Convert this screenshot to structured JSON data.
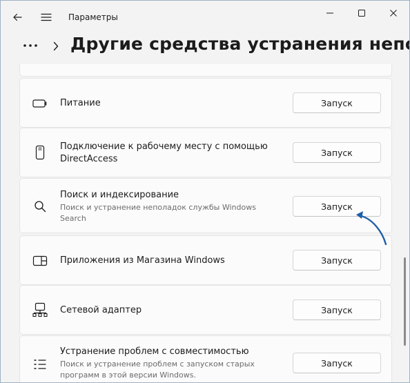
{
  "window": {
    "title": "Параметры"
  },
  "header": {
    "page_title": "Другие средства устранения неполадок"
  },
  "items": [
    {
      "icon": "battery-icon",
      "title": "Питание",
      "description": "",
      "button": "Запуск"
    },
    {
      "icon": "mobile-device-icon",
      "title": "Подключение к рабочему месту с помощью DirectAccess",
      "description": "",
      "button": "Запуск"
    },
    {
      "icon": "search-icon",
      "title": "Поиск и индексирование",
      "description": "Поиск и устранение неполадок службы Windows Search",
      "button": "Запуск"
    },
    {
      "icon": "store-apps-icon",
      "title": "Приложения из Магазина Windows",
      "description": "",
      "button": "Запуск"
    },
    {
      "icon": "network-adapter-icon",
      "title": "Сетевой адаптер",
      "description": "",
      "button": "Запуск"
    },
    {
      "icon": "compatibility-list-icon",
      "title": "Устранение проблем с совместимостью",
      "description": "Поиск и устранение проблем с запуском старых программ в этой версии Windows.",
      "button": "Запуск"
    }
  ],
  "colors": {
    "background": "#f3f3f3",
    "card": "#fbfbfb",
    "annotation_arrow": "#1f5fa8"
  }
}
